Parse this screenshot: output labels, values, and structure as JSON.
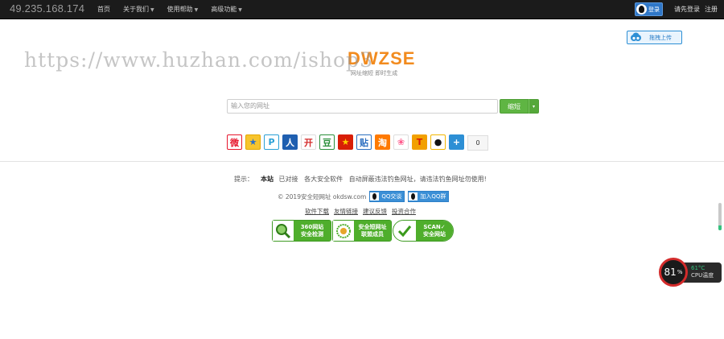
{
  "topbar": {
    "ip": "49.235.168.174",
    "nav": [
      {
        "label": "首页",
        "dropdown": false
      },
      {
        "label": "关于我们",
        "dropdown": true
      },
      {
        "label": "使用帮助",
        "dropdown": true
      },
      {
        "label": "高级功能",
        "dropdown": true
      }
    ],
    "login_label": "登录",
    "login_prompt": "请先登录",
    "register": "注册"
  },
  "upload": {
    "label": "拖拽上传",
    "icon": "cloud-upload-icon"
  },
  "watermark": "https://www.huzhan.com/ishop3",
  "logo": {
    "text": "DWZSE",
    "subtitle": "网址缩短 即时生成",
    "color": "#f28b1e"
  },
  "search": {
    "placeholder": "输入您的网址",
    "button": "缩短",
    "dropdown_caret": "▾"
  },
  "share": {
    "icons": [
      {
        "name": "weibo-icon",
        "glyph": "微",
        "bg": "#fff",
        "fg": "#e6162d",
        "border": "#e6162d"
      },
      {
        "name": "qzone-icon",
        "glyph": "★",
        "bg": "#f7c42d",
        "fg": "#2a6fc9",
        "border": "#e4a800"
      },
      {
        "name": "tqq-icon",
        "glyph": "P",
        "bg": "#fff",
        "fg": "#2aa0d6",
        "border": "#2aa0d6"
      },
      {
        "name": "renren-icon",
        "glyph": "人",
        "bg": "#1f5fb0",
        "fg": "#fff",
        "border": "#1f5fb0"
      },
      {
        "name": "kaixin-icon",
        "glyph": "开",
        "bg": "#fff",
        "fg": "#d42b2b",
        "border": "#ddd"
      },
      {
        "name": "douban-icon",
        "glyph": "豆",
        "bg": "#fff",
        "fg": "#2a8f3a",
        "border": "#2a8f3a"
      },
      {
        "name": "baidu-icon",
        "glyph": "★",
        "bg": "#d81e06",
        "fg": "#ffd000",
        "border": "#d81e06"
      },
      {
        "name": "tieba-icon",
        "glyph": "贴",
        "bg": "#fff",
        "fg": "#2d6fc0",
        "border": "#2d6fc0"
      },
      {
        "name": "taobao-icon",
        "glyph": "淘",
        "bg": "#ff7a00",
        "fg": "#fff",
        "border": "#ff7a00"
      },
      {
        "name": "meilishuo-icon",
        "glyph": "❀",
        "bg": "#fff",
        "fg": "#ff5a8c",
        "border": "#ddd"
      },
      {
        "name": "tianya-icon",
        "glyph": "T",
        "bg": "#f2a000",
        "fg": "#d81e06",
        "border": "#f2a000"
      },
      {
        "name": "qq-friend-icon",
        "glyph": "●",
        "bg": "#fff",
        "fg": "#111",
        "border": "#f2b600"
      },
      {
        "name": "more-share-icon",
        "glyph": "+",
        "bg": "#2d8fd5",
        "fg": "#fff",
        "border": "#2d8fd5"
      }
    ],
    "count": "0"
  },
  "footer": {
    "tip_label": "提示：",
    "tip_site": "本站",
    "tip_parts": [
      "已对接",
      "各大安全软件",
      "自动屏蔽违法钓鱼网址，请违法钓鱼网址勿使用!"
    ],
    "copyright": "© 2019安全短网址 okdsw.com",
    "qq_contact": "QQ交谈",
    "qq_group": "加入QQ群",
    "links": [
      "软件下载",
      "友情链接",
      "建议反馈",
      "投资合作"
    ]
  },
  "badges": [
    {
      "name": "badge-360",
      "line1": "360网站",
      "line2": "安全检测",
      "icon": "magnifier-icon"
    },
    {
      "name": "badge-union",
      "line1": "安全短网址",
      "line2": "联盟成员",
      "icon": "seal-icon"
    },
    {
      "name": "badge-scan",
      "line1": "SCAN✓",
      "line2": "安全网站",
      "icon": "checkmark-icon"
    }
  ],
  "cpu": {
    "percent": "81",
    "percent_unit": "%",
    "temp": "61°C",
    "label": "CPU温度",
    "alert_color": "#d32b2b"
  }
}
